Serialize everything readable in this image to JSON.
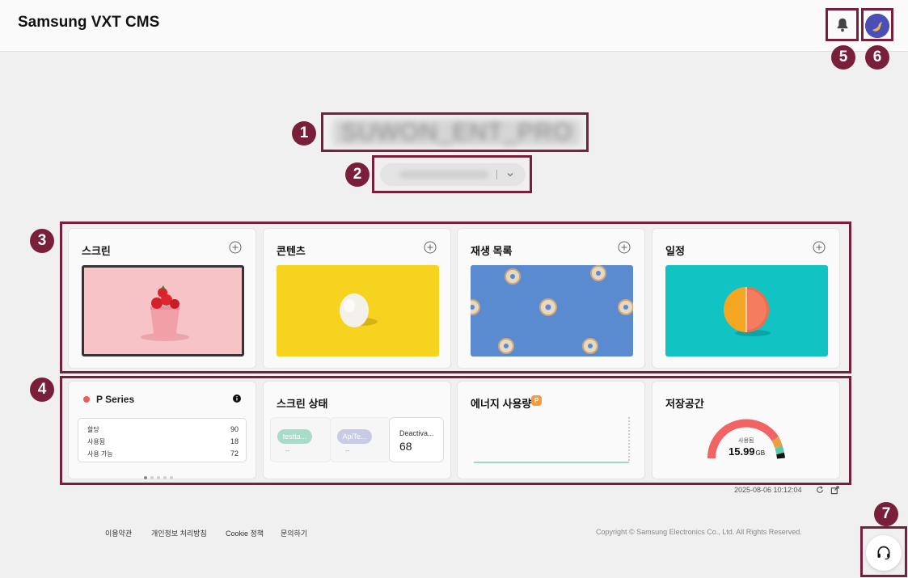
{
  "app": {
    "title": "Samsung VXT CMS"
  },
  "org": {
    "name": "SUWON_ENT_PRO",
    "selector_value": ""
  },
  "callouts": [
    "1",
    "2",
    "3",
    "4",
    "5",
    "6",
    "7"
  ],
  "feature_cards": [
    {
      "title": "스크린"
    },
    {
      "title": "콘텐츠"
    },
    {
      "title": "재생 목록"
    },
    {
      "title": "일정"
    }
  ],
  "widgets": {
    "license": {
      "title": "P Series",
      "rows": [
        {
          "label": "할당",
          "value": "90"
        },
        {
          "label": "사용됨",
          "value": "18"
        },
        {
          "label": "사용 가능",
          "value": "72"
        }
      ]
    },
    "screen_status": {
      "title": "스크린 상태",
      "chips": [
        {
          "label": "testta...",
          "dash": "--"
        },
        {
          "label": "ApiTe...",
          "dash": "--"
        }
      ],
      "deactivated_label": "Deactiva...",
      "deactivated_value": "68"
    },
    "energy": {
      "title": "에너지 사용량",
      "badge": "P"
    },
    "storage": {
      "title": "저장공간",
      "used_label": "사용됨",
      "used_value": "15.99",
      "unit": "GB"
    }
  },
  "timestamp": "2025-08-06 10:12:04",
  "footer": {
    "links": [
      "이용약관",
      "개인정보 처리방침",
      "Cookie 정책",
      "문의하기"
    ],
    "copyright": "Copyright © Samsung Electronics Co., Ltd. All Rights Reserved."
  },
  "colors": {
    "accent_mark": "#7a1f3a",
    "status_dot": "#f05a5a",
    "storage_ring": "#f26363",
    "energy_line": "#5cc9a7"
  }
}
